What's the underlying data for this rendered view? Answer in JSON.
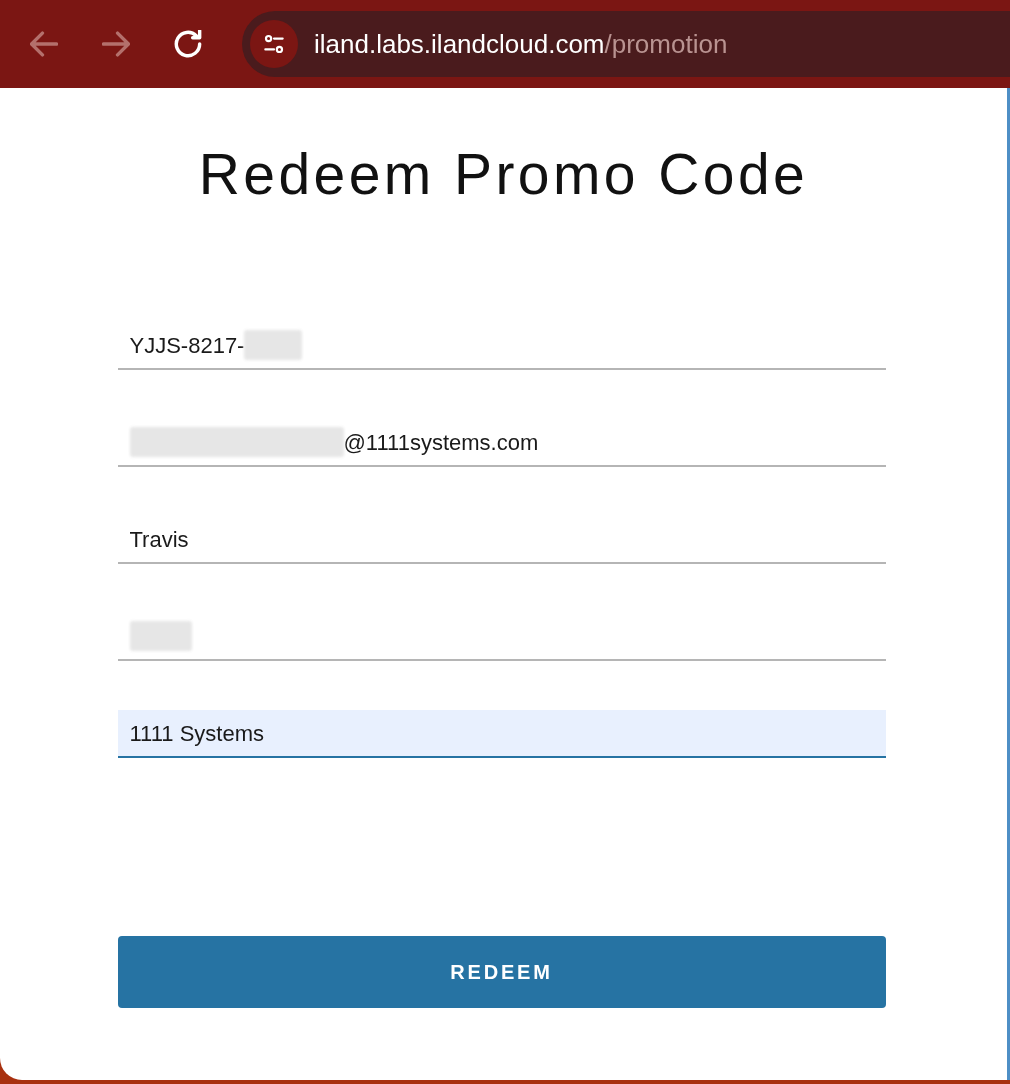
{
  "browser": {
    "nav": [
      {
        "kind": "back",
        "disabled": true
      },
      {
        "kind": "forward",
        "disabled": true
      },
      {
        "kind": "reload",
        "disabled": false
      }
    ],
    "url": {
      "host": "iland.labs.ilandcloud.com",
      "path": "/promotion"
    }
  },
  "page": {
    "title": "Redeem Promo Code"
  },
  "form": {
    "fields": [
      {
        "parts": [
          {
            "kind": "text",
            "text": "YJJS-8217-"
          },
          {
            "kind": "redacted"
          }
        ],
        "focused": false
      },
      {
        "parts": [
          {
            "kind": "redacted"
          },
          {
            "kind": "text",
            "text": "@1111systems.com"
          }
        ],
        "focused": false
      },
      {
        "parts": [
          {
            "kind": "text",
            "text": "Travis"
          }
        ],
        "focused": false
      },
      {
        "parts": [
          {
            "kind": "redacted"
          }
        ],
        "focused": false
      },
      {
        "parts": [
          {
            "kind": "text",
            "text": "1111 Systems"
          }
        ],
        "focused": true
      }
    ],
    "submit": {
      "label": "REDEEM"
    }
  }
}
